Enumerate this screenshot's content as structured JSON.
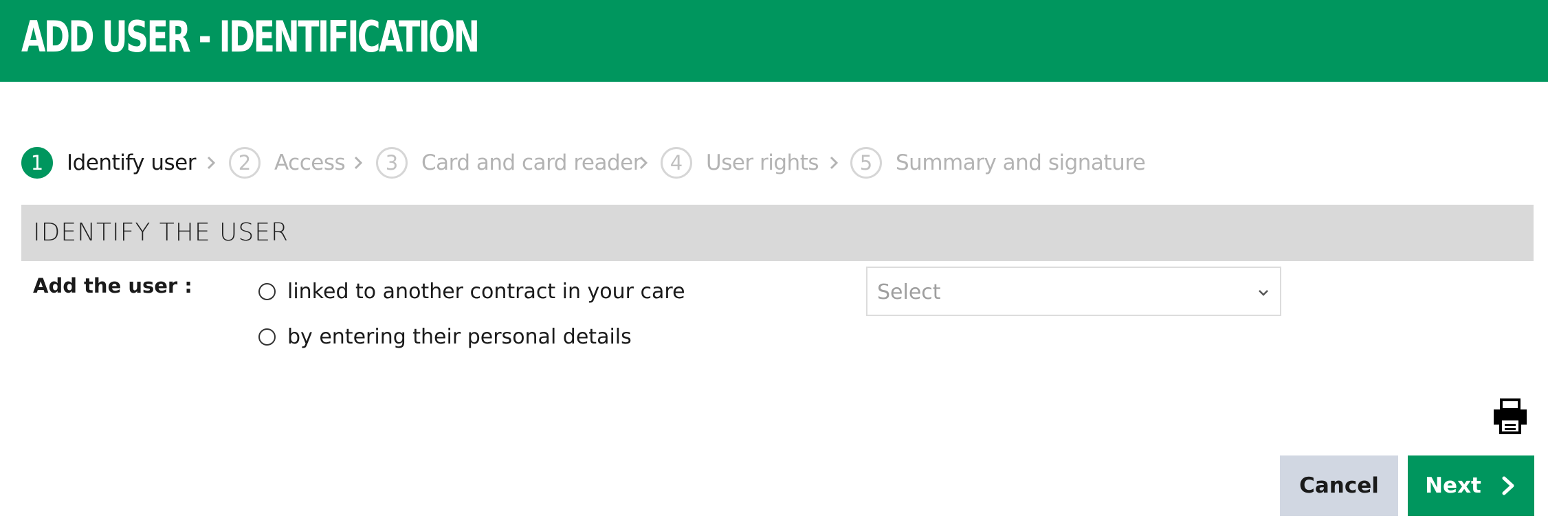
{
  "header": {
    "title": "ADD USER - IDENTIFICATION",
    "background_color": "#00965e"
  },
  "stepper": {
    "steps": [
      {
        "number": "1",
        "label": "Identify user",
        "active": true
      },
      {
        "number": "2",
        "label": "Access",
        "active": false
      },
      {
        "number": "3",
        "label": "Card and card reader",
        "active": false
      },
      {
        "number": "4",
        "label": "User rights",
        "active": false
      },
      {
        "number": "5",
        "label": "Summary and signature",
        "active": false
      }
    ],
    "separator_icon": "chevron-right-icon"
  },
  "section": {
    "title": "IDENTIFY THE USER",
    "field_label": "Add the user :",
    "options": [
      {
        "label": "linked to another contract in your care",
        "selected": false
      },
      {
        "label": "by entering their personal details",
        "selected": false
      }
    ],
    "select": {
      "value": "Select",
      "icon": "chevron-down-icon"
    }
  },
  "actions": {
    "print_icon": "printer-icon",
    "cancel_label": "Cancel",
    "next_label": "Next",
    "next_icon": "chevron-right-icon",
    "next_color": "#00965e",
    "cancel_color": "#d1d7e2"
  }
}
